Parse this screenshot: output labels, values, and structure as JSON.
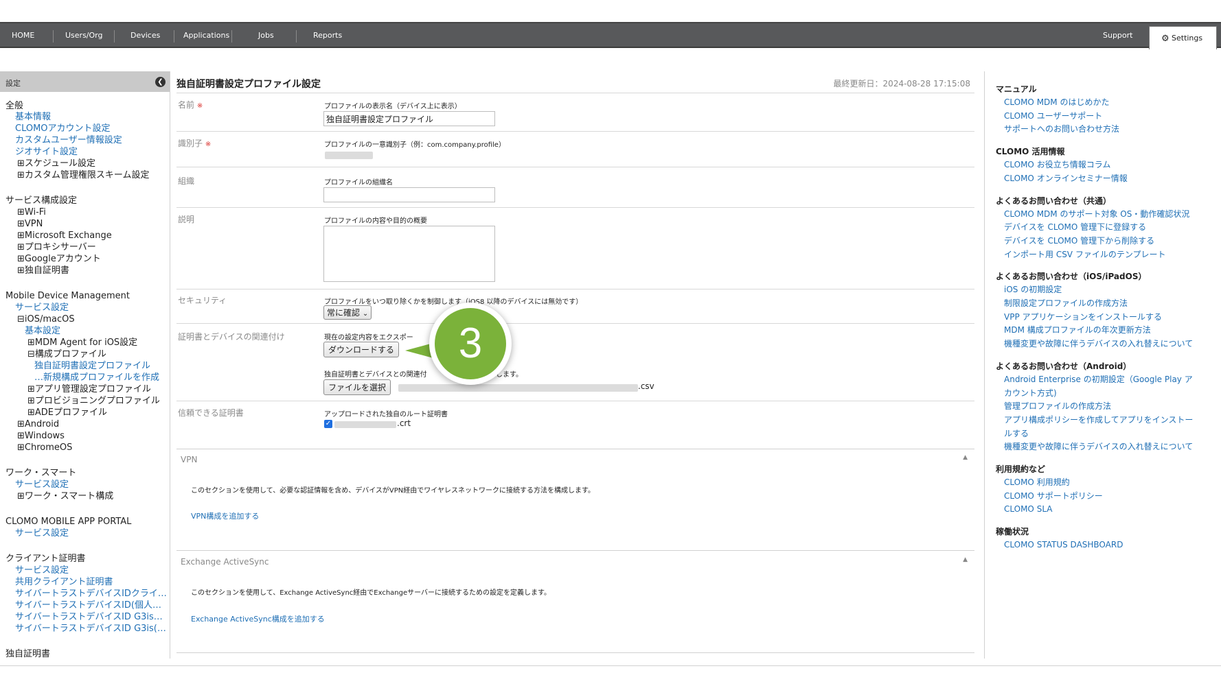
{
  "nav": {
    "items": [
      "HOME",
      "Users/Org",
      "Devices",
      "Applications",
      "Jobs",
      "Reports"
    ],
    "support": "Support",
    "settings": "Settings"
  },
  "sidebar": {
    "header": "設定",
    "items": [
      {
        "text": "全般",
        "type": "heading"
      },
      {
        "text": "基本情報",
        "type": "link"
      },
      {
        "text": "CLOMOアカウント設定",
        "type": "link"
      },
      {
        "text": "カスタムユーザー情報設定",
        "type": "link"
      },
      {
        "text": "ジオサイト設定",
        "type": "link"
      },
      {
        "text": "⊞スケジュール設定",
        "type": "expander"
      },
      {
        "text": "⊞カスタム管理権限スキーム設定",
        "type": "expander"
      },
      {
        "text": "サービス構成設定",
        "type": "heading"
      },
      {
        "text": "⊞Wi-Fi",
        "type": "expander"
      },
      {
        "text": "⊞VPN",
        "type": "expander"
      },
      {
        "text": "⊞Microsoft Exchange",
        "type": "expander"
      },
      {
        "text": "⊞プロキシサーバー",
        "type": "expander"
      },
      {
        "text": "⊞Googleアカウント",
        "type": "expander"
      },
      {
        "text": "⊞独自証明書",
        "type": "expander"
      },
      {
        "text": "Mobile Device Management",
        "type": "heading"
      },
      {
        "text": "サービス設定",
        "type": "link"
      },
      {
        "text": "⊟iOS/macOS",
        "type": "expander"
      },
      {
        "text": "基本設定",
        "type": "link"
      },
      {
        "text": "⊞MDM Agent for iOS設定",
        "type": "expander"
      },
      {
        "text": "⊟構成プロファイル",
        "type": "expander"
      },
      {
        "text": "独自証明書設定プロファイル",
        "type": "link"
      },
      {
        "text": "…新規構成プロファイルを作成",
        "type": "link"
      },
      {
        "text": "⊞アプリ管理設定プロファイル",
        "type": "expander"
      },
      {
        "text": "⊞プロビジョニングプロファイル",
        "type": "expander"
      },
      {
        "text": "⊞ADEプロファイル",
        "type": "expander"
      },
      {
        "text": "⊞Android",
        "type": "expander"
      },
      {
        "text": "⊞Windows",
        "type": "expander"
      },
      {
        "text": "⊞ChromeOS",
        "type": "expander"
      },
      {
        "text": "ワーク・スマート",
        "type": "heading"
      },
      {
        "text": "サービス設定",
        "type": "link"
      },
      {
        "text": "⊞ワーク・スマート構成",
        "type": "expander"
      },
      {
        "text": "CLOMO MOBILE APP PORTAL",
        "type": "heading"
      },
      {
        "text": "サービス設定",
        "type": "link"
      },
      {
        "text": "クライアント証明書",
        "type": "heading"
      },
      {
        "text": "サービス設定",
        "type": "link"
      },
      {
        "text": "共用クライアント証明書",
        "type": "link"
      },
      {
        "text": "サイバートラストデバイスIDクライ…",
        "type": "link"
      },
      {
        "text": "サイバートラストデバイスID(個人…",
        "type": "link"
      },
      {
        "text": "サイバートラストデバイスID G3is…",
        "type": "link"
      },
      {
        "text": "サイバートラストデバイスID G3is(…",
        "type": "link"
      },
      {
        "text": "独自証明書",
        "type": "heading"
      }
    ]
  },
  "main": {
    "title": "独自証明書設定プロファイル設定",
    "updated": "最終更新日：2024-08-28 17:15:08",
    "required_mark": "※",
    "fields": {
      "name": {
        "label": "名前",
        "desc": "プロファイルの表示名（デバイス上に表示）",
        "value": "独自証明書設定プロファイル"
      },
      "identifier": {
        "label": "識別子",
        "desc": "プロファイルの一意識別子（例：com.company.profile）"
      },
      "organization": {
        "label": "組織",
        "desc": "プロファイルの組織名",
        "value": ""
      },
      "description": {
        "label": "説明",
        "desc": "プロファイルの内容や目的の概要",
        "value": ""
      },
      "security": {
        "label": "セキュリティ",
        "desc": "プロファイルをいつ取り除くかを制御します（iOS8 以降のデバイスには無効です）",
        "select": "常に確認"
      },
      "cert_assoc": {
        "label": "証明書とデバイスの関連付け",
        "desc1": "現在の設定内容をエクスポー",
        "download_button": "ダウンロードする",
        "desc2_a": "独自証明書とデバイスとの関連付",
        "desc2_b": "します。",
        "file_button": "ファイルを選択",
        "file_suffix": ".csv"
      },
      "trusted": {
        "label": "信頼できる証明書",
        "desc": "アップロードされた独自のルート証明書",
        "file_suffix": ".crt"
      }
    },
    "sections": {
      "vpn": {
        "title": "VPN",
        "desc": "このセクションを使用して、必要な認証情報を含め、デバイスがVPN経由でワイヤレスネットワークに接続する方法を構成します。",
        "link": "VPN構成を追加する"
      },
      "eas": {
        "title": "Exchange ActiveSync",
        "desc": "このセクションを使用して、Exchange ActiveSync経由でExchangeサーバーに接続するための設定を定義します。",
        "link": "Exchange ActiveSync構成を追加する"
      }
    },
    "step": "3"
  },
  "rightpanel": {
    "groups": [
      {
        "heading": "マニュアル",
        "links": [
          "CLOMO MDM のはじめかた",
          "CLOMO ユーザーサポート",
          "サポートへのお問い合わせ方法"
        ]
      },
      {
        "heading": "CLOMO 活用情報",
        "links": [
          "CLOMO お役立ち情報コラム",
          "CLOMO オンラインセミナー情報"
        ]
      },
      {
        "heading": "よくあるお問い合わせ（共通）",
        "links": [
          "CLOMO MDM のサポート対象 OS・動作確認状況",
          "デバイスを CLOMO 管理下に登録する",
          "デバイスを CLOMO 管理下から削除する",
          "インポート用 CSV ファイルのテンプレート"
        ]
      },
      {
        "heading": "よくあるお問い合わせ（iOS/iPadOS）",
        "links": [
          "iOS の初期設定",
          "制限設定プロファイルの作成方法",
          "VPP アプリケーションをインストールする",
          "MDM 構成プロファイルの年次更新方法",
          "機種変更や故障に伴うデバイスの入れ替えについて"
        ]
      },
      {
        "heading": "よくあるお問い合わせ（Android）",
        "links": [
          "Android Enterprise の初期設定（Google Play ア",
          "カウント方式)",
          "管理プロファイルの作成方法",
          "アプリ構成ポリシーを作成してアプリをインストー",
          "ルする",
          "機種変更や故障に伴うデバイスの入れ替えについて"
        ]
      },
      {
        "heading": "利用規約など",
        "links": [
          "CLOMO 利用規約",
          "CLOMO サポートポリシー",
          "CLOMO SLA"
        ]
      },
      {
        "heading": "稼働状況",
        "links": [
          "CLOMO STATUS DASHBOARD"
        ]
      }
    ]
  }
}
